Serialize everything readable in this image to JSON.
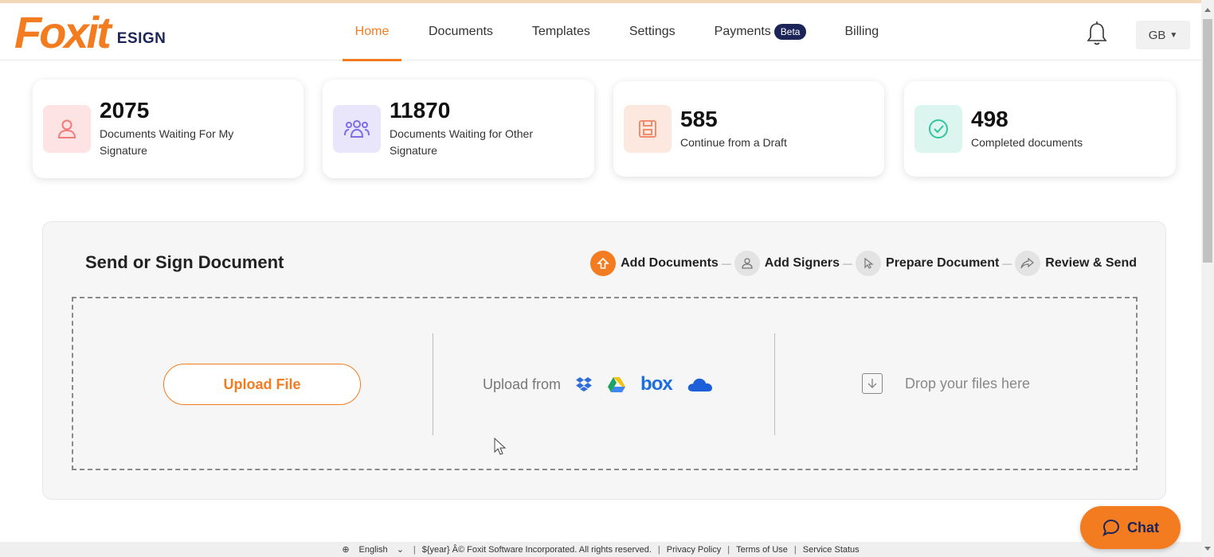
{
  "brand": {
    "logo_text": "Foxit",
    "logo_sub": "ESIGN"
  },
  "nav": {
    "items": [
      {
        "label": "Home",
        "active": true
      },
      {
        "label": "Documents",
        "active": false
      },
      {
        "label": "Templates",
        "active": false
      },
      {
        "label": "Settings",
        "active": false
      },
      {
        "label": "Payments",
        "active": false,
        "badge": "Beta"
      },
      {
        "label": "Billing",
        "active": false
      }
    ]
  },
  "user": {
    "initials": "GB"
  },
  "stats": [
    {
      "value": "2075",
      "label": "Documents Waiting For My Signature",
      "icon": "user-icon",
      "color": "#fde3e3"
    },
    {
      "value": "11870",
      "label": "Documents Waiting for Other Signature",
      "icon": "users-icon",
      "color": "#e9e6fb"
    },
    {
      "value": "585",
      "label": "Continue from a Draft",
      "icon": "save-icon",
      "color": "#fde8e0"
    },
    {
      "value": "498",
      "label": "Completed documents",
      "icon": "check-circle-icon",
      "color": "#dcf5ee"
    }
  ],
  "send_panel": {
    "title": "Send or Sign Document",
    "steps": [
      "Add Documents",
      "Add Signers",
      "Prepare Document",
      "Review & Send"
    ],
    "upload_button": "Upload File",
    "upload_from_label": "Upload from",
    "providers": [
      "dropbox-icon",
      "google-drive-icon",
      "box-icon",
      "onedrive-icon"
    ],
    "box_label": "box",
    "drop_label": "Drop your files here"
  },
  "footer": {
    "language": "English",
    "copyright": "${year} Â© Foxit Software Incorporated. All rights reserved.",
    "links": [
      "Privacy Policy",
      "Terms of Use",
      "Service Status"
    ]
  },
  "chat": {
    "label": "Chat"
  },
  "colors": {
    "accent": "#f37c21",
    "navy": "#1c2559"
  }
}
